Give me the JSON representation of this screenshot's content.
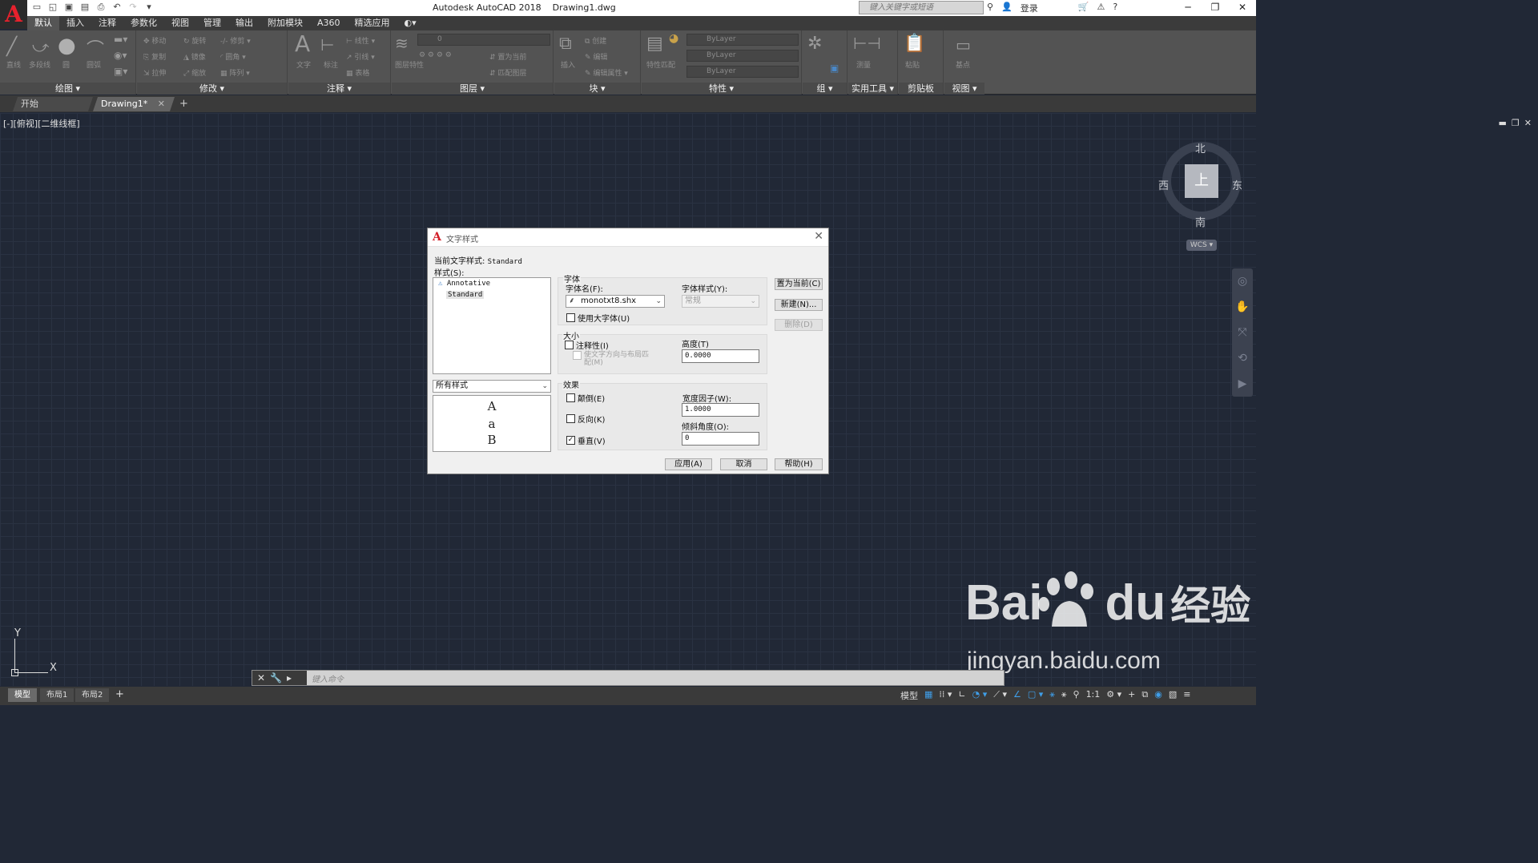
{
  "app": {
    "title": "Autodesk AutoCAD 2018",
    "document": "Drawing1.dwg",
    "logo": "A",
    "search_placeholder": "键入关键字或短语",
    "login": "登录"
  },
  "menu_tabs": [
    "默认",
    "插入",
    "注释",
    "参数化",
    "视图",
    "管理",
    "输出",
    "附加模块",
    "A360",
    "精选应用"
  ],
  "ribbon": {
    "panels": [
      "绘图",
      "修改",
      "注释",
      "图层",
      "块",
      "特性",
      "组",
      "实用工具",
      "剪贴板",
      "视图"
    ],
    "draw_tools": [
      "直线",
      "多段线",
      "圆",
      "圆弧"
    ],
    "modify_tools": [
      "移动",
      "旋转",
      "修剪",
      "复制",
      "镜像",
      "圆角",
      "拉伸",
      "缩放",
      "阵列"
    ],
    "annotate_tools": [
      "文字",
      "标注",
      "线性",
      "引线",
      "表格"
    ],
    "layer_tools": [
      "图层特性",
      "置为当前",
      "匹配图层"
    ],
    "layer_value": "0",
    "block_tools": [
      "插入",
      "创建",
      "编辑",
      "编辑属性"
    ],
    "properties_tools": [
      "特性匹配"
    ],
    "properties_values": [
      "ByLayer",
      "ByLayer",
      "ByLayer"
    ],
    "utility_tools": [
      "测量"
    ],
    "clipboard_tools": [
      "粘贴"
    ],
    "view_tools": [
      "基点"
    ]
  },
  "doc_tabs": [
    "开始",
    "Drawing1*"
  ],
  "viewport": {
    "label": "[-][俯视][二维线框]",
    "compass": {
      "north": "北",
      "south": "南",
      "east": "东",
      "west": "西",
      "top": "上"
    },
    "wcs": "WCS",
    "ucs_x": "X",
    "ucs_y": "Y"
  },
  "command_placeholder": "键入命令",
  "layout_tabs": [
    "模型",
    "布局1",
    "布局2"
  ],
  "status": {
    "model": "模型",
    "scale": "1:1"
  },
  "watermark": {
    "brand": "Bai",
    "du": "du",
    "suffix": "经验",
    "url": "jingyan.baidu.com"
  },
  "dialog": {
    "title": "文字样式",
    "current_style_label": "当前文字样式:",
    "current_style_value": "Standard",
    "styles_label": "样式(S):",
    "styles": [
      "Annotative",
      "Standard"
    ],
    "selected_style": "Standard",
    "filter_value": "所有样式",
    "preview_chars": [
      "A",
      "a",
      "B"
    ],
    "font_group": "字体",
    "font_name_label": "字体名(F):",
    "font_name_value": "monotxt8.shx",
    "font_style_label": "字体样式(Y):",
    "font_style_value": "常规",
    "use_big_font": "使用大字体(U)",
    "use_big_font_checked": false,
    "size_group": "大小",
    "annotative_label": "注释性(I)",
    "annotative_checked": false,
    "match_orientation": "使文字方向与布局匹配(M)",
    "height_label": "高度(T)",
    "height_value": "0.0000",
    "effects_group": "效果",
    "upside_down": "颠倒(E)",
    "upside_down_checked": false,
    "backwards": "反向(K)",
    "backwards_checked": false,
    "vertical": "垂直(V)",
    "vertical_checked": true,
    "width_factor_label": "宽度因子(W):",
    "width_factor_value": "1.0000",
    "oblique_label": "倾斜角度(O):",
    "oblique_value": "0",
    "buttons": {
      "set_current": "置为当前(C)",
      "new": "新建(N)...",
      "delete": "删除(D)",
      "apply": "应用(A)",
      "cancel": "取消",
      "help": "帮助(H)"
    }
  },
  "colors": {
    "canvas": "#212836",
    "ribbon": "#535353",
    "dialog": "#f0f0f0",
    "accent": "#3f9ee8",
    "logo_red": "#e8212d"
  }
}
